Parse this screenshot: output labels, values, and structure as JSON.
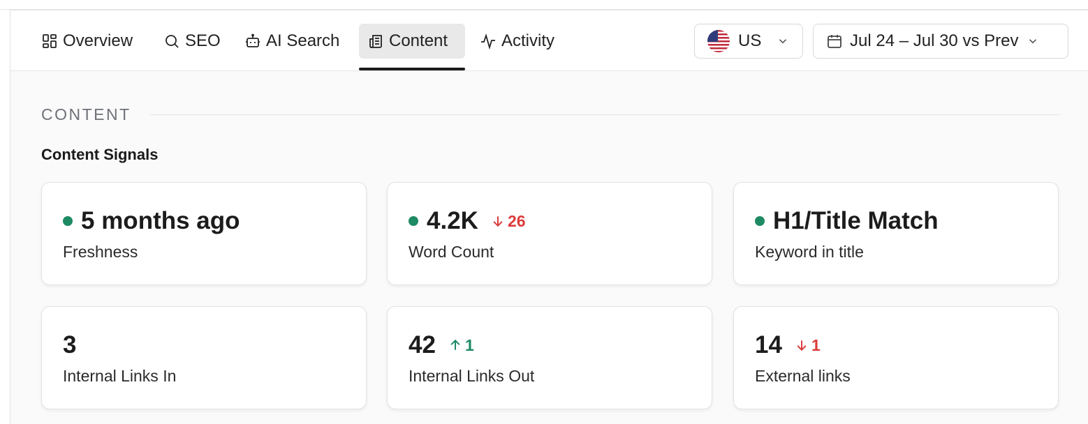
{
  "nav": {
    "tabs": [
      {
        "label": "Overview",
        "icon": "grid-icon"
      },
      {
        "label": "SEO",
        "icon": "search-icon"
      },
      {
        "label": "AI Search",
        "icon": "robot-icon"
      },
      {
        "label": "Content",
        "icon": "newspaper-icon",
        "active": true
      },
      {
        "label": "Activity",
        "icon": "activity-icon"
      }
    ],
    "region": {
      "label": "US",
      "icon": "us-flag-icon"
    },
    "date_range": {
      "label": "Jul 24 – Jul 30 vs Prev",
      "icon": "calendar-icon"
    }
  },
  "section": {
    "label": "CONTENT",
    "subheading": "Content Signals"
  },
  "cards": [
    {
      "value": "5 months ago",
      "label": "Freshness",
      "status": "good"
    },
    {
      "value": "4.2K",
      "label": "Word Count",
      "status": "good",
      "delta": "26",
      "delta_dir": "down"
    },
    {
      "value": "H1/Title Match",
      "label": "Keyword in title",
      "status": "good"
    },
    {
      "value": "3",
      "label": "Internal Links In"
    },
    {
      "value": "42",
      "label": "Internal Links Out",
      "delta": "1",
      "delta_dir": "up"
    },
    {
      "value": "14",
      "label": "External links",
      "delta": "1",
      "delta_dir": "down"
    }
  ],
  "colors": {
    "good": "#1e8a63",
    "down": "#dc3b3b",
    "up": "#1e8a63"
  }
}
